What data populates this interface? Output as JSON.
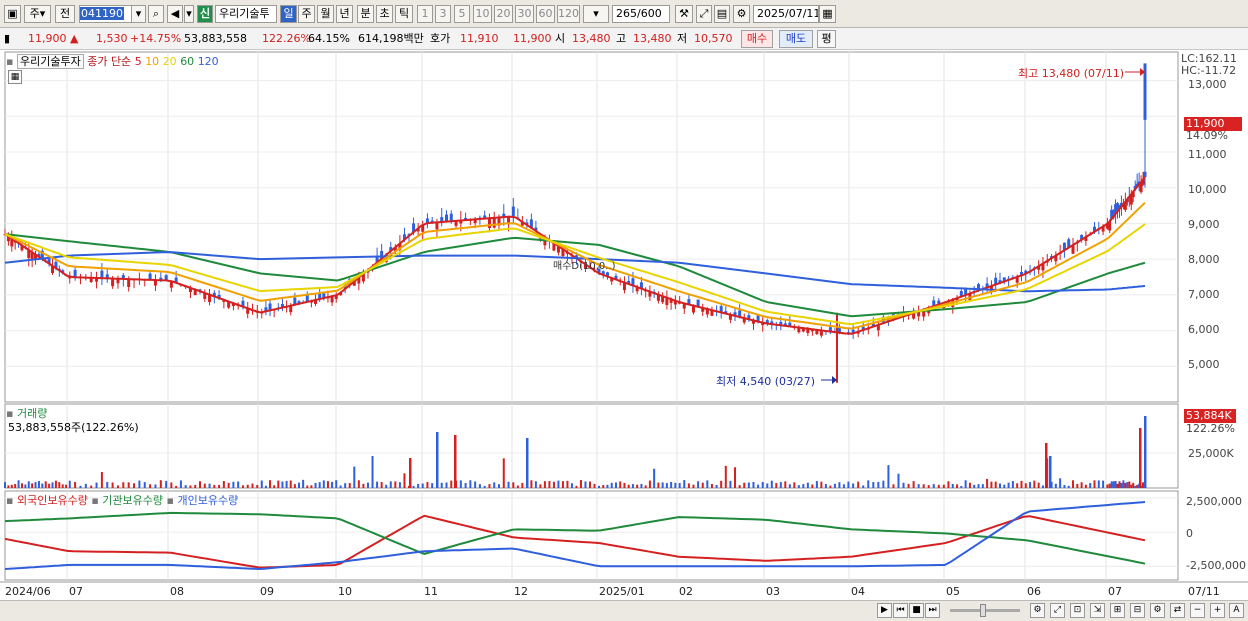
{
  "toolbar": {
    "type_label": "주",
    "prev_label": "전",
    "stock_code": "041190",
    "new_label": "신",
    "stock_name": "우리기술투",
    "period_tabs": [
      "일",
      "주",
      "월",
      "년",
      "분",
      "초",
      "틱"
    ],
    "active_period": "일",
    "intervals": [
      "1",
      "3",
      "5",
      "10",
      "20",
      "30",
      "60",
      "120"
    ],
    "count_value": "265",
    "count_total": "/600",
    "date_value": "2025/07/11"
  },
  "quote": {
    "price": "11,900",
    "change": "1,530",
    "change_pct": "+14.75%",
    "volume": "53,883,558",
    "volume_pct": "122.26%",
    "turnover_pct": "64.15%",
    "amount": "614,198백만",
    "ask_label": "호가",
    "ask1": "11,910",
    "ask2": "11,900",
    "open_label": "시",
    "open": "13,480",
    "high_label": "고",
    "high": "13,480",
    "low_label": "저",
    "low": "10,570",
    "buy_label": "매수",
    "sell_label": "매도",
    "eval_label": "평"
  },
  "price_panel": {
    "stock_name": "우리기술투자",
    "ma_label": "종가 단순",
    "ma_periods": [
      {
        "period": "5",
        "color": "#d42020"
      },
      {
        "period": "10",
        "color": "#f0a000"
      },
      {
        "period": "20",
        "color": "#e8d400"
      },
      {
        "period": "60",
        "color": "#1f8a3c"
      },
      {
        "period": "120",
        "color": "#2f5fdc"
      }
    ],
    "lc": "LC:162.11",
    "hc": "HC:-11.72",
    "high_annot": "최고 13,480 (07/11)",
    "low_annot": "최저 4,540 (03/27)",
    "trade_annot": "매수D(10,0..)",
    "current_price": "11,900",
    "current_pct": "14.09%",
    "y_ticks": [
      "13,000",
      "12,000",
      "11,000",
      "10,000",
      "9,000",
      "8,000",
      "7,000",
      "6,000",
      "5,000"
    ]
  },
  "volume_panel": {
    "title": "거래량",
    "value_line": "53,883,558주(122.26%)",
    "badge": "53,884K",
    "badge_pct": "122.26%",
    "y_tick": "25,000K"
  },
  "holding_panel": {
    "series": [
      {
        "name": "외국인보유수량",
        "color": "#d42020"
      },
      {
        "name": "기관보유수량",
        "color": "#1f8a3c"
      },
      {
        "name": "개인보유수량",
        "color": "#2f5fdc"
      }
    ],
    "y_ticks": [
      "2,500,000",
      "0",
      "-2,500,000"
    ]
  },
  "x_ticks": [
    "2024/06",
    "07",
    "08",
    "09",
    "10",
    "11",
    "12",
    "2025/01",
    "02",
    "03",
    "04",
    "05",
    "06",
    "07"
  ],
  "x_last": "07/11",
  "chart_data": [
    {
      "type": "line",
      "title": "우리기술투자",
      "ylim": [
        4000,
        13800
      ],
      "x": [
        "2024/06",
        "07",
        "08",
        "09",
        "10",
        "11",
        "12",
        "2025/01",
        "02",
        "03",
        "04",
        "05",
        "06",
        "07",
        "07/11"
      ],
      "series": [
        {
          "name": "5",
          "values": [
            8700,
            7500,
            7400,
            6500,
            7000,
            9000,
            9200,
            7600,
            6800,
            6200,
            5900,
            6800,
            7600,
            9000,
            10300
          ]
        },
        {
          "name": "60",
          "values": [
            8700,
            8500,
            8200,
            7600,
            7400,
            8200,
            8600,
            8400,
            7800,
            6800,
            6400,
            6600,
            6800,
            7600,
            7900
          ]
        },
        {
          "name": "120",
          "values": [
            7900,
            8100,
            8200,
            8000,
            8050,
            8100,
            8100,
            8000,
            7900,
            7600,
            7300,
            7200,
            7100,
            7150,
            7250
          ]
        }
      ],
      "annotations": [
        "최고 13,480 (07/11)",
        "최저 4,540 (03/27)"
      ]
    },
    {
      "type": "bar",
      "title": "거래량",
      "values_note": "53,883,558주(122.26%)",
      "last_value_k": 53884
    },
    {
      "type": "line",
      "ylim": [
        -3500000,
        3000000
      ],
      "series": [
        {
          "name": "외국인보유수량",
          "values": [
            -500000,
            -1400000,
            -1500000,
            -2600000,
            -2400000,
            1200000,
            -400000,
            -800000,
            -1800000,
            -2100000,
            -1800000,
            -800000,
            1200000,
            -600000
          ]
        },
        {
          "name": "기관보유수량",
          "values": [
            800000,
            1000000,
            1400000,
            1300000,
            1000000,
            -1600000,
            200000,
            100000,
            1100000,
            900000,
            200000,
            -100000,
            -600000,
            -2300000
          ]
        },
        {
          "name": "개인보유수량",
          "values": [
            -2700000,
            -2400000,
            -2400000,
            -2700000,
            -2200000,
            -1400000,
            -1200000,
            -2500000,
            -2500000,
            -2500000,
            -2500000,
            -2400000,
            1500000,
            2200000
          ]
        }
      ]
    }
  ]
}
